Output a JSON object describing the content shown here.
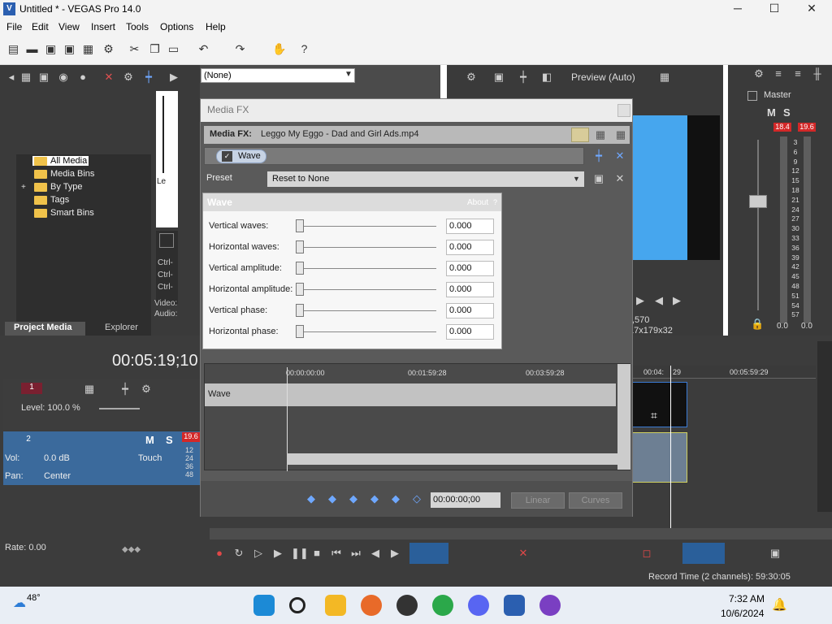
{
  "window": {
    "title": "Untitled * - VEGAS Pro 14.0",
    "logo": "V",
    "minimize_icon": "─",
    "maximize_icon": "☐",
    "close_icon": "✕"
  },
  "menu": [
    "File",
    "Edit",
    "View",
    "Insert",
    "Tools",
    "Options",
    "Help"
  ],
  "project_media": {
    "tree": [
      "All Media",
      "Media Bins",
      "By Type",
      "Tags",
      "Smart Bins"
    ],
    "expander": "+",
    "tabs": [
      "Project Media",
      "Explorer"
    ],
    "side_texts": [
      "Le",
      "Ctrl-",
      "Ctrl-",
      "Ctrl-",
      "Video:",
      "Audio:"
    ]
  },
  "preview": {
    "dropdown_value": "(None)",
    "quality": "Preview (Auto)",
    "info": ",570",
    "info2": "17x179x32"
  },
  "master": {
    "title": "Master",
    "left_peak": "18.4",
    "right_peak": "19.6",
    "scale": [
      "3",
      "6",
      "9",
      "12",
      "15",
      "18",
      "21",
      "24",
      "27",
      "30",
      "33",
      "36",
      "39",
      "42",
      "45",
      "48",
      "51",
      "54",
      "57"
    ],
    "left_value": "0.0",
    "right_value": "0.0",
    "m": "M",
    "s": "S"
  },
  "dialog": {
    "title": "Media FX",
    "fx_label": "Media FX:",
    "fx_file": "Leggo My Eggo - Dad and Girl Ads.mp4",
    "chain_item": "Wave",
    "preset_label": "Preset",
    "preset_value": "Reset to None",
    "panel_title": "Wave",
    "about": "About",
    "help": "?",
    "params": [
      {
        "label": "Vertical waves:",
        "value": "0.000"
      },
      {
        "label": "Horizontal waves:",
        "value": "0.000"
      },
      {
        "label": "Vertical amplitude:",
        "value": "0.000"
      },
      {
        "label": "Horizontal amplitude:",
        "value": "0.000"
      },
      {
        "label": "Vertical phase:",
        "value": "0.000"
      },
      {
        "label": "Horizontal phase:",
        "value": "0.000"
      }
    ],
    "ruler": [
      "00:00:00:00",
      "00:01:59:28",
      "00:03:59:28"
    ],
    "lane": "Wave",
    "timecode": "00:00:00;00",
    "linear": "Linear",
    "curves": "Curves"
  },
  "timeline": {
    "timecode": "00:05:19;10",
    "ruler_right": [
      "00:04:",
      "29",
      "00:05:59:29"
    ],
    "track1": {
      "num": "1",
      "level": "Level: 100.0 %"
    },
    "track2": {
      "num": "2",
      "vol_label": "Vol:",
      "vol": "0.0 dB",
      "pan_label": "Pan:",
      "pan": "Center",
      "touch": "Touch",
      "peak": "19.6",
      "meter": [
        "12",
        "24",
        "36",
        "48"
      ],
      "m": "M",
      "s": "S"
    },
    "rate": "Rate: 0.00",
    "record_time": "Record Time (2 channels): 59:30:05"
  },
  "taskbar": {
    "temp": "48°",
    "time": "7:32 AM",
    "date": "10/6/2024"
  }
}
